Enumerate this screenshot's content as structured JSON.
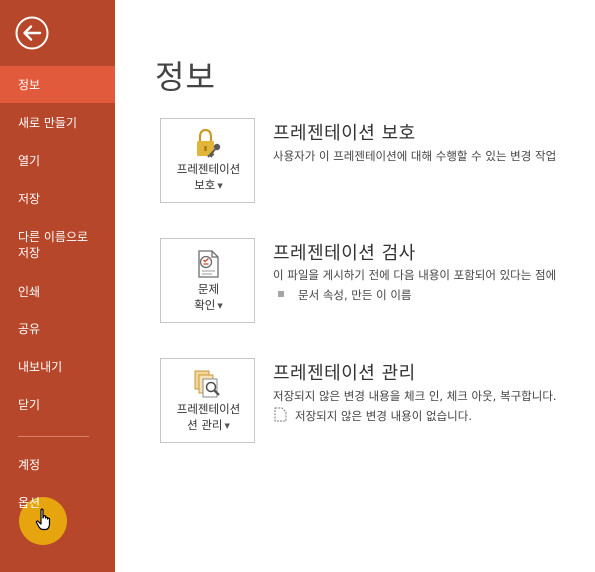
{
  "sidebar": {
    "items": [
      {
        "label": "정보"
      },
      {
        "label": "새로 만들기"
      },
      {
        "label": "열기"
      },
      {
        "label": "저장"
      },
      {
        "label": "다른 이름으로\n저장"
      },
      {
        "label": "인쇄"
      },
      {
        "label": "공유"
      },
      {
        "label": "내보내기"
      },
      {
        "label": "닫기"
      },
      {
        "label": "계정"
      },
      {
        "label": "옵션"
      }
    ],
    "active_index": 0
  },
  "page": {
    "title": "정보"
  },
  "sections": [
    {
      "tile_line1": "프레젠테이션",
      "tile_line2": "보호",
      "tile_icon": "lock-key-icon",
      "title": "프레젠테이션 보호",
      "description": "사용자가 이 프레젠테이션에 대해 수행할 수 있는 변경 작업"
    },
    {
      "tile_line1": "문제",
      "tile_line2": "확인",
      "tile_icon": "inspect-document-icon",
      "title": "프레젠테이션 검사",
      "description": "이 파일을 게시하기 전에 다음 내용이 포함되어 있다는 점에",
      "bullet": "문서 속성, 만든 이 이름"
    },
    {
      "tile_line1": "프레젠테이션",
      "tile_line2": "션 관리",
      "tile_icon": "manage-versions-icon",
      "title": "프레젠테이션 관리",
      "description": "저장되지 않은 변경 내용을 체크 인, 체크 아웃, 복구합니다.",
      "bullet": "저장되지 않은 변경 내용이 없습니다."
    }
  ],
  "colors": {
    "sidebar_bg": "#b7472a",
    "active_item_bg": "#e05a3b",
    "cursor_highlight": "#e8ab0e"
  }
}
